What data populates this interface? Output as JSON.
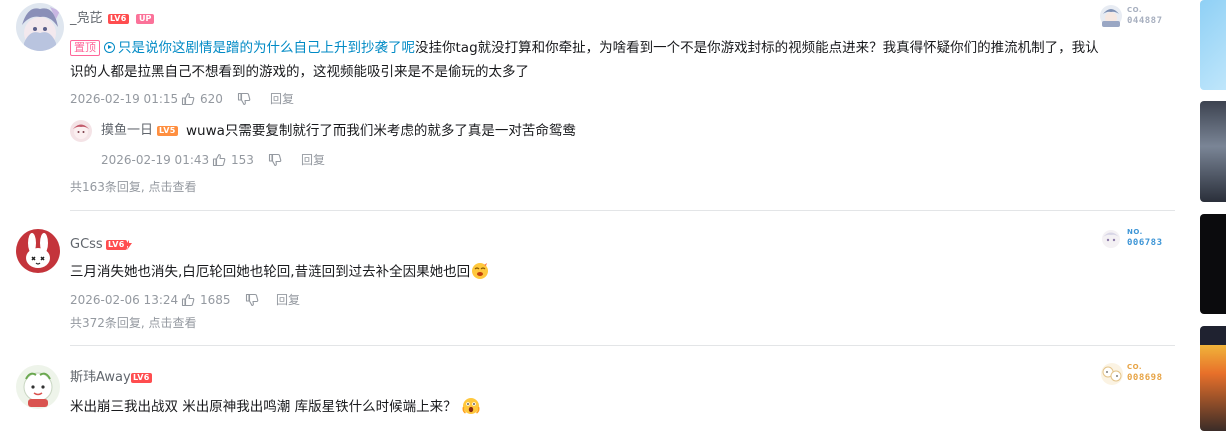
{
  "comments": [
    {
      "username": "_凫芘",
      "level": "LV6",
      "up_label": "UP",
      "pinned_label": "置顶",
      "jump_text": "只是说你这剧情是蹭的为什么自己上升到抄袭了呢",
      "text_line1": "没挂你tag就没打算和你牵扯，为啥看到一个不是你游戏封标的视频能点进来？我真得怀疑你们的推流机制了，我认",
      "text_line2": "识的人都是拉黑自己不想看到的游戏的，这视频能吸引来是不是偷玩的太多了",
      "time": "2026-02-19 01:15",
      "likes": "620",
      "reply_label": "回复",
      "fan_badge": {
        "label": "CO.",
        "number": "044887"
      },
      "sub_reply": {
        "username": "摸鱼一日",
        "level": "LV5",
        "text": "wuwa只需要复制就行了而我们米考虑的就多了真是一对苦命鸳鸯",
        "time": "2026-02-19 01:43",
        "likes": "153",
        "reply_label": "回复"
      },
      "reply_count_text": "共163条回复, 点击查看"
    },
    {
      "username": "GCss",
      "level": "LV6",
      "text": "三月消失她也消失,白厄轮回她也轮回,昔涟回到过去补全因果她也回",
      "time": "2026-02-06 13:24",
      "likes": "1685",
      "reply_label": "回复",
      "fan_badge": {
        "label": "NO.",
        "number": "006783"
      },
      "reply_count_text": "共372条回复, 点击查看"
    },
    {
      "username": "斯玮Away",
      "level": "LV6",
      "text": "米出崩三我出战双 米出原神我出鸣潮 库版星铁什么时候端上来？",
      "fan_badge": {
        "label": "CO.",
        "number": "008698"
      }
    }
  ],
  "colors": {
    "accent_pink": "#ff6699",
    "link_blue": "#008ac5",
    "meta_gray": "#9499a0",
    "level_red": "#ff4d4f"
  }
}
